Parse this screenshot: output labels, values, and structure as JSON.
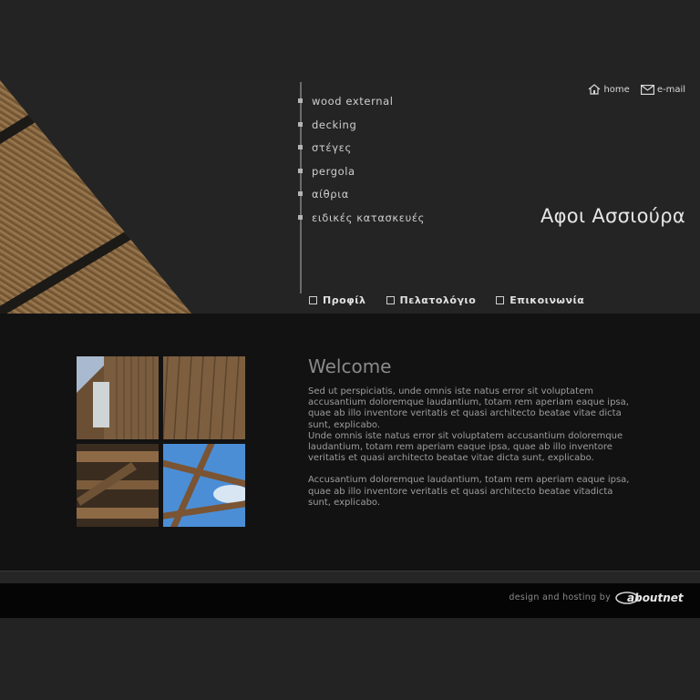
{
  "nav": {
    "items": [
      {
        "label": "wood external"
      },
      {
        "label": "decking"
      },
      {
        "label": "στέγες"
      },
      {
        "label": "pergola"
      },
      {
        "label": "αίθρια"
      },
      {
        "label": "ειδικές κατασκευές"
      }
    ]
  },
  "top_links": {
    "home": "home",
    "email": "e-mail"
  },
  "brand": "Αφοι Ασσιούρα",
  "sub_links": [
    "Προφίλ",
    "Πελατολόγιο",
    "Επικοινωνία"
  ],
  "welcome": {
    "title": "Welcome",
    "paragraphs": [
      "Sed ut perspiciatis, unde omnis iste natus error sit voluptatem accusantium doloremque laudantium, totam rem aperiam eaque ipsa, quae ab illo inventore veritatis et quasi architecto beatae vitae dicta sunt, explicabo.",
      "Unde omnis iste natus error sit voluptatem accusantium doloremque laudantium, totam rem aperiam eaque ipsa, quae ab illo inventore veritatis et quasi architecto beatae vitae dicta sunt, explicabo.",
      "Accusantium doloremque laudantium, totam rem aperiam eaque ipsa, quae ab illo inventore veritatis et quasi architecto beatae vitadicta sunt, explicabo."
    ]
  },
  "footer": {
    "credit": "design and hosting by",
    "logo_text": "aboutnet"
  },
  "colors": {
    "page_bg": "#232323",
    "content_bg": "#121212",
    "footer_bg": "#050505",
    "wood": "#8a6a44"
  },
  "icons": {
    "home": "house-icon",
    "email": "envelope-icon",
    "checkbox": "checkbox-icon"
  }
}
